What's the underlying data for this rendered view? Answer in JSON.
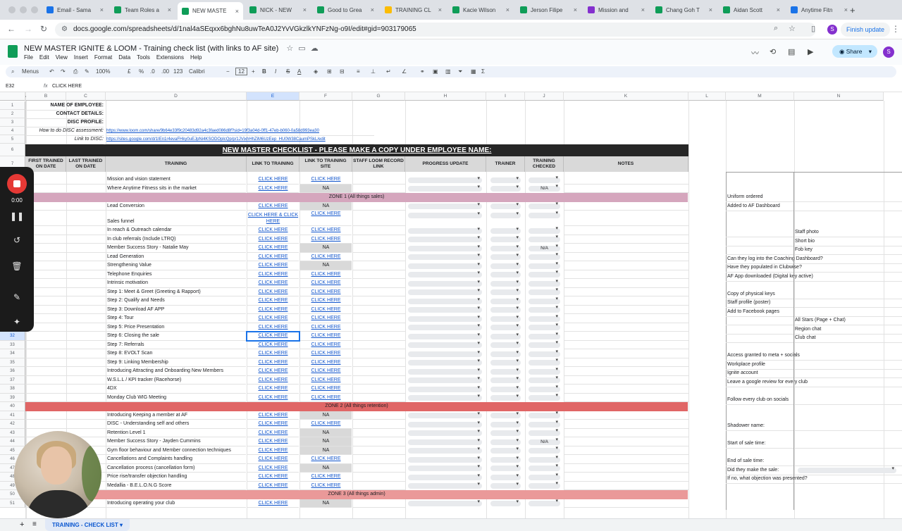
{
  "browser": {
    "tabs": [
      {
        "label": "Email - Sama",
        "color": "#1a73e8"
      },
      {
        "label": "Team Roles a",
        "color": "#0f9d58"
      },
      {
        "label": "NEW MASTE",
        "color": "#0f9d58",
        "active": true
      },
      {
        "label": "NICK - NEW",
        "color": "#0f9d58"
      },
      {
        "label": "Good to Grea",
        "color": "#0f9d58"
      },
      {
        "label": "TRAINING CL",
        "color": "#fbbc04"
      },
      {
        "label": "Kacie Wilson",
        "color": "#0f9d58"
      },
      {
        "label": "Jerson Filipe",
        "color": "#0f9d58"
      },
      {
        "label": "Mission and",
        "color": "#8430ce"
      },
      {
        "label": "Chang Goh T",
        "color": "#0f9d58"
      },
      {
        "label": "Aidan Scott",
        "color": "#0f9d58"
      },
      {
        "label": "Anytime Fitn",
        "color": "#1a73e8"
      }
    ],
    "url": "docs.google.com/spreadsheets/d/1nal4aSEqxx6bghNu8uwTeA0J2YvVGkzlkYNFzNg-o9I/edit#gid=903179065",
    "finish_update": "Finish update",
    "profile_letter": "S"
  },
  "doc": {
    "title": "NEW MASTER IGNITE & LOOM - Training check list (with links to AF site)",
    "menus": [
      "File",
      "Edit",
      "View",
      "Insert",
      "Format",
      "Data",
      "Tools",
      "Extensions",
      "Help"
    ],
    "share_label": "Share"
  },
  "toolbar": {
    "menus_label": "Menus",
    "zoom": "100%",
    "currency": "£",
    "percent": "%",
    "decimals_less": ".0",
    "decimals_more": ".00",
    "number_format": "123",
    "font": "Calibri",
    "font_size": "12",
    "bold": "B",
    "italic": "I",
    "strike": "S",
    "text_color": "A"
  },
  "formula_bar": {
    "cell_ref": "E32",
    "fx": "fx",
    "content": "CLICK HERE"
  },
  "columns": [
    "A",
    "B",
    "C",
    "D",
    "E",
    "F",
    "G",
    "H",
    "I",
    "J",
    "K",
    "L",
    "M",
    "N"
  ],
  "header_info": {
    "name_label": "NAME OF EMPLOYEE:",
    "contact_label": "CONTACT DETAILS:",
    "disc_label": "DISC PROFILE:",
    "disc_how_label": "How to do DISC assessment:",
    "disc_how_link": "https://www.loom.com/share/9b64e33f9c20483d92a4c3faed086d8f?sid=19f3a04d-0ff1-47eb-b060-0a58d993ea30",
    "disc_link_label": "Link to DISC:",
    "disc_link": "https://sites.google.com/d/1IEn1r4evaFHky0uEJpNi4KSODOplcQp/p/1JVixhHhZiM6UzEep_HU0W38CaumPSkL/edit"
  },
  "checklist_title": "NEW MASTER CHECKLIST - PLEASE MAKE A COPY UNDER EMPLOYEE NAME:",
  "table_headers": {
    "first_trained": "FIRST TRAINED ON DATE",
    "last_trained": "LAST TRAINED ON DATE",
    "training": "TRAINING",
    "link_training": "LINK TO TRAINING",
    "link_site": "LINK TO TRAINING SITE",
    "loom": "STAFF LOOM RECORD LINK",
    "progress": "PROGRESS UPDATE",
    "trainer": "TRAINER",
    "checked": "TRAINING CHECKED",
    "notes": "NOTES"
  },
  "rows": [
    {
      "n": "9",
      "t": "Mission and vision statement",
      "e": "CLICK HERE",
      "f": "CLICK HERE",
      "j": ""
    },
    {
      "n": "10",
      "t": "Where Anytime Fitness sits in the market",
      "e": "CLICK HERE",
      "f": "NA",
      "j": "N/A"
    },
    {
      "n": "11",
      "zone": "ZONE 1 (All things sales)",
      "zcolor": "#d5a6bd"
    },
    {
      "n": "12",
      "t": "Lead Conversion",
      "e": "CLICK HERE",
      "f": "NA",
      "j": ""
    },
    {
      "n": "13",
      "t": "Sales funnel",
      "e": "CLICK HERE & CLICK HERE",
      "f": "CLICK HERE",
      "j": "",
      "tall": true
    },
    {
      "n": "14",
      "t": "In reach & Outreach calendar",
      "e": "CLICK HERE",
      "f": "CLICK HERE",
      "j": ""
    },
    {
      "n": "15",
      "t": "In club referrals (Include LTRQ)",
      "e": "CLICK HERE",
      "f": "CLICK HERE",
      "j": ""
    },
    {
      "n": "16",
      "t": "Member Success Story - Natalie May",
      "e": "CLICK HERE",
      "f": "NA",
      "j": "N/A"
    },
    {
      "n": "17",
      "t": "Lead Generation",
      "e": "CLICK HERE",
      "f": "CLICK HERE",
      "j": ""
    },
    {
      "n": "18",
      "t": "Strengthening Value",
      "e": "CLICK HERE",
      "f": "NA",
      "j": ""
    },
    {
      "n": "19",
      "t": "Telephone Enquiries",
      "e": "CLICK HERE",
      "f": "CLICK HERE",
      "j": ""
    },
    {
      "n": "20",
      "t": "Intrinsic motivation",
      "e": "CLICK HERE",
      "f": "CLICK HERE",
      "j": ""
    },
    {
      "n": "21",
      "t": "Step 1: Meet & Greet (Greeting & Rapport)",
      "e": "CLICK HERE",
      "f": "CLICK HERE",
      "j": ""
    },
    {
      "n": "22",
      "t": "Step 2: Qualify and Needs",
      "e": "CLICK HERE",
      "f": "CLICK HERE",
      "j": ""
    },
    {
      "n": "23",
      "t": "Step 3: Download AF APP",
      "e": "CLICK HERE",
      "f": "CLICK HERE",
      "j": ""
    },
    {
      "n": "24",
      "t": "Step 4: Tour",
      "e": "CLICK HERE",
      "f": "CLICK HERE",
      "j": ""
    },
    {
      "n": "25",
      "t": "Step 5: Price Presentation",
      "e": "CLICK HERE",
      "f": "CLICK HERE",
      "j": ""
    },
    {
      "n": "32",
      "t": "Step 6: Closing the sale",
      "e": "CLICK HERE",
      "f": "CLICK HERE",
      "j": "",
      "sel": true
    },
    {
      "n": "33",
      "t": "Step 7: Referrals",
      "e": "CLICK HERE",
      "f": "CLICK HERE",
      "j": ""
    },
    {
      "n": "34",
      "t": "Step 8: EVOLT Scan",
      "e": "CLICK HERE",
      "f": "CLICK HERE",
      "j": ""
    },
    {
      "n": "35",
      "t": "Step 9: Linking Membership",
      "e": "CLICK HERE",
      "f": "CLICK HERE",
      "j": ""
    },
    {
      "n": "36",
      "t": "Introducing Attracting and Onboarding New Members",
      "e": "CLICK HERE",
      "f": "CLICK HERE",
      "j": ""
    },
    {
      "n": "37",
      "t": "W.S.L.L / KPI tracker (Racehorse)",
      "e": "CLICK HERE",
      "f": "CLICK HERE",
      "j": ""
    },
    {
      "n": "38",
      "t": "4DX",
      "e": "CLICK HERE",
      "f": "CLICK HERE",
      "j": ""
    },
    {
      "n": "39",
      "t": "Monday Club WIG Meeting",
      "e": "CLICK HERE",
      "f": "CLICK HERE",
      "j": ""
    },
    {
      "n": "40",
      "zone": "ZONE 2 (All things retention)",
      "zcolor": "#e06666"
    },
    {
      "n": "41",
      "t": "Introducing Keeping a member at AF",
      "e": "CLICK HERE",
      "f": "NA",
      "j": ""
    },
    {
      "n": "42",
      "t": "DISC - Understanding self and others",
      "e": "CLICK HERE",
      "f": "CLICK HERE",
      "j": ""
    },
    {
      "n": "43",
      "t": "Retention Level 1",
      "e": "CLICK HERE",
      "f": "NA",
      "j": ""
    },
    {
      "n": "44",
      "t": "Member Success Story - Jayden Cummins",
      "e": "CLICK HERE",
      "f": "NA",
      "j": "N/A"
    },
    {
      "n": "45",
      "t": "Gym floor behaviour and Member connection techniques",
      "e": "CLICK HERE",
      "f": "NA",
      "j": ""
    },
    {
      "n": "46",
      "t": "Cancellations and Complaints handling",
      "e": "CLICK HERE",
      "f": "CLICK HERE",
      "j": ""
    },
    {
      "n": "47",
      "t": "Cancellation process (cancellation form)",
      "e": "CLICK HERE",
      "f": "NA",
      "j": ""
    },
    {
      "n": "48",
      "t": "Price rise/transfer objection handling",
      "e": "CLICK HERE",
      "f": "CLICK HERE",
      "j": ""
    },
    {
      "n": "49",
      "t": "Medallia - B.E.L.O.N.G Score",
      "e": "CLICK HERE",
      "f": "CLICK HERE",
      "j": ""
    },
    {
      "n": "50",
      "zone": "ZONE 3 (All things admin)",
      "zcolor": "#ea9999"
    },
    {
      "n": "51",
      "t": "Introducing operating your club",
      "e": "CLICK HERE",
      "f": "NA",
      "j": ""
    }
  ],
  "side_list": [
    {
      "row": 2,
      "m": "Uniform ordered",
      "n": ""
    },
    {
      "row": 3,
      "m": "Added to AF Dashboard",
      "n": ""
    },
    {
      "row": 6,
      "m": "",
      "n": "Staff photo"
    },
    {
      "row": 7,
      "m": "",
      "n": "Short bio"
    },
    {
      "row": 8,
      "m": "",
      "n": "Fob key"
    },
    {
      "row": 9,
      "m": "Can they log into the Coaching Dashboard?",
      "n": ""
    },
    {
      "row": 10,
      "m": "Have they populated in Clubwise?",
      "n": ""
    },
    {
      "row": 11,
      "m": "AF App downloaded (Digital key active)",
      "n": ""
    },
    {
      "row": 13,
      "m": "Copy of physical keys",
      "n": ""
    },
    {
      "row": 14,
      "m": "Staff profile (poster)",
      "n": ""
    },
    {
      "row": 15,
      "m": "Add to Facebook pages",
      "n": ""
    },
    {
      "row": 16,
      "m": "",
      "n": "All Stars (Page + Chat)"
    },
    {
      "row": 17,
      "m": "",
      "n": "Region chat"
    },
    {
      "row": 18,
      "m": "",
      "n": "Club chat"
    },
    {
      "row": 20,
      "m": "Access granted to meta + socials",
      "n": ""
    },
    {
      "row": 21,
      "m": "Workplace profile",
      "n": ""
    },
    {
      "row": 22,
      "m": "Ignite account",
      "n": ""
    },
    {
      "row": 23,
      "m": "Leave a google review for every club",
      "n": ""
    },
    {
      "row": 25,
      "m": "Follow every club on socials",
      "n": ""
    },
    {
      "row": 28,
      "m": "Shadower name:",
      "n": ""
    },
    {
      "row": 30,
      "m": "Start of sale time:",
      "n": ""
    },
    {
      "row": 32,
      "m": "End of sale time:",
      "n": ""
    },
    {
      "row": 33,
      "m": "Did they make the sale:",
      "n": ""
    },
    {
      "row": 34,
      "m": "If no, what objection was presented?",
      "n": ""
    }
  ],
  "recorder": {
    "time": "0:00"
  },
  "sheet_tab": "TRAINING - CHECK LIST"
}
